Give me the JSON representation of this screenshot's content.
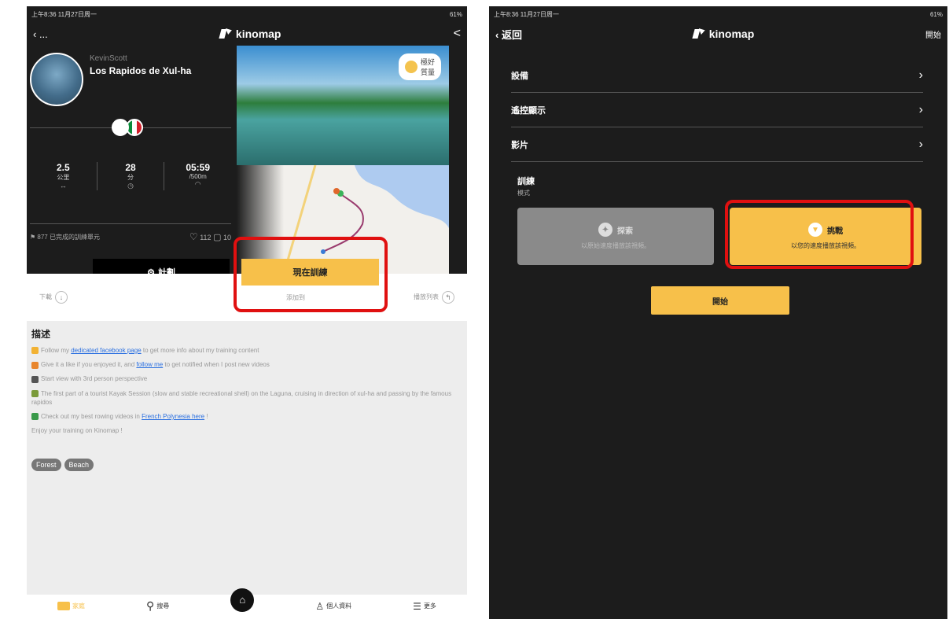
{
  "left": {
    "status": {
      "time": "上午8:36  11月27日周一",
      "right": "61%"
    },
    "nav": {
      "back": "‹ ...",
      "brand": "kinomap"
    },
    "profile": {
      "username": "KevinScott",
      "title": "Los Rapidos de Xul-ha"
    },
    "photo_badge": {
      "line1": "極好",
      "line2": "質量"
    },
    "stats": [
      {
        "value": "2.5",
        "unit": "公里",
        "icon": "↔"
      },
      {
        "value": "28",
        "unit": "分",
        "icon": "◷"
      },
      {
        "value": "05:59",
        "unit": "/500m",
        "icon": "◠"
      }
    ],
    "social": {
      "completed": "877 已完成的訓練單元",
      "likes": "112",
      "comments": "10"
    },
    "buttons": {
      "plan": "計劃",
      "train_now": "現在訓練"
    },
    "actions": {
      "download": "下載",
      "add_to": "添加到",
      "playlist": "播放列表"
    },
    "description": {
      "title": "描述",
      "lines": [
        {
          "pre": "Follow my ",
          "link": "dedicated facebook page",
          "post": " to get more info about my training content"
        },
        {
          "pre": "Give it a like if you enjoyed it, and ",
          "link": "follow me",
          "post": " to get notified when I post new videos"
        },
        {
          "pre": "Start view with 3rd person perspective",
          "link": "",
          "post": ""
        },
        {
          "pre": "The first part of a tourist Kayak Session (slow and stable recreational shell) on the Laguna, cruising in direction of xul-ha and passing by the famous rapidos",
          "link": "",
          "post": ""
        },
        {
          "pre": "Check out my best rowing videos in ",
          "link": "French Polynesia here",
          "post": " !"
        },
        {
          "pre": "Enjoy your training on Kinomap !",
          "link": "",
          "post": ""
        }
      ],
      "tags": [
        "Forest",
        "Beach"
      ]
    },
    "tabbar": {
      "home": "家庭",
      "search": "搜尋",
      "profile": "個人資料",
      "more": "更多"
    }
  },
  "right": {
    "status": {
      "time": "上午8:36  11月27日周一",
      "right": "61%"
    },
    "nav": {
      "back": "返回",
      "brand": "kinomap",
      "action": "開始"
    },
    "menu": [
      "設備",
      "遙控顯示",
      "影片"
    ],
    "training": {
      "title": "訓練",
      "subtitle": "模式"
    },
    "modes": {
      "explore": {
        "title": "探索",
        "desc": "以原始速度播放該視頻。"
      },
      "challenge": {
        "title": "挑戰",
        "desc": "以您的速度播放該視頻。"
      }
    },
    "start_button": "開始"
  },
  "colors": {
    "accent": "#f7c04a",
    "highlight": "#e01010",
    "dark": "#1c1c1c"
  }
}
